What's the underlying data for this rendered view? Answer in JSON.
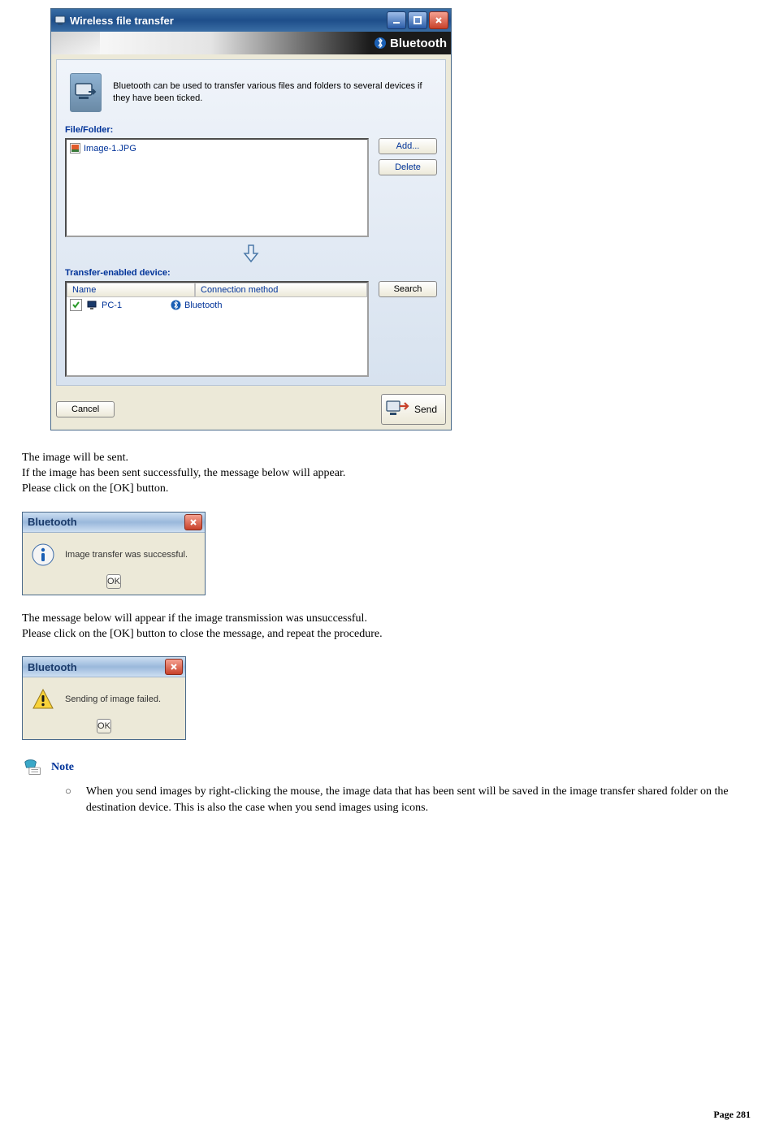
{
  "main_window": {
    "title": "Wireless file transfer",
    "brand": "Bluetooth",
    "intro_text": "Bluetooth can be used to transfer various files and folders to several devices if they have been ticked.",
    "file_folder_label": "File/Folder:",
    "file_item": "Image-1.JPG",
    "add_button": "Add...",
    "delete_button": "Delete",
    "transfer_label": "Transfer-enabled device:",
    "col_name": "Name",
    "col_connection": "Connection method",
    "device_name": "PC-1",
    "device_conn": "Bluetooth",
    "search_button": "Search",
    "cancel_button": "Cancel",
    "send_button": "Send"
  },
  "doc": {
    "para1_l1": "The image will be sent.",
    "para1_l2": "If the image has been sent successfully, the message below will appear.",
    "para1_l3": "Please click on the [OK] button.",
    "para2_l1": "The message below will appear if the image transmission was unsuccessful.",
    "para2_l2": "Please click on the [OK] button to close the message, and repeat the procedure."
  },
  "dialog_success": {
    "title": "Bluetooth",
    "message": "Image transfer was successful.",
    "ok": "OK"
  },
  "dialog_fail": {
    "title": "Bluetooth",
    "message": "Sending of image failed.",
    "ok": "OK"
  },
  "note": {
    "label": "Note",
    "item": "When you send images by right-clicking the mouse, the image data that has been sent will be saved in the image transfer shared folder on the destination device. This is also the case when you send images using icons."
  },
  "footer": {
    "label": "Page ",
    "number": "281"
  }
}
